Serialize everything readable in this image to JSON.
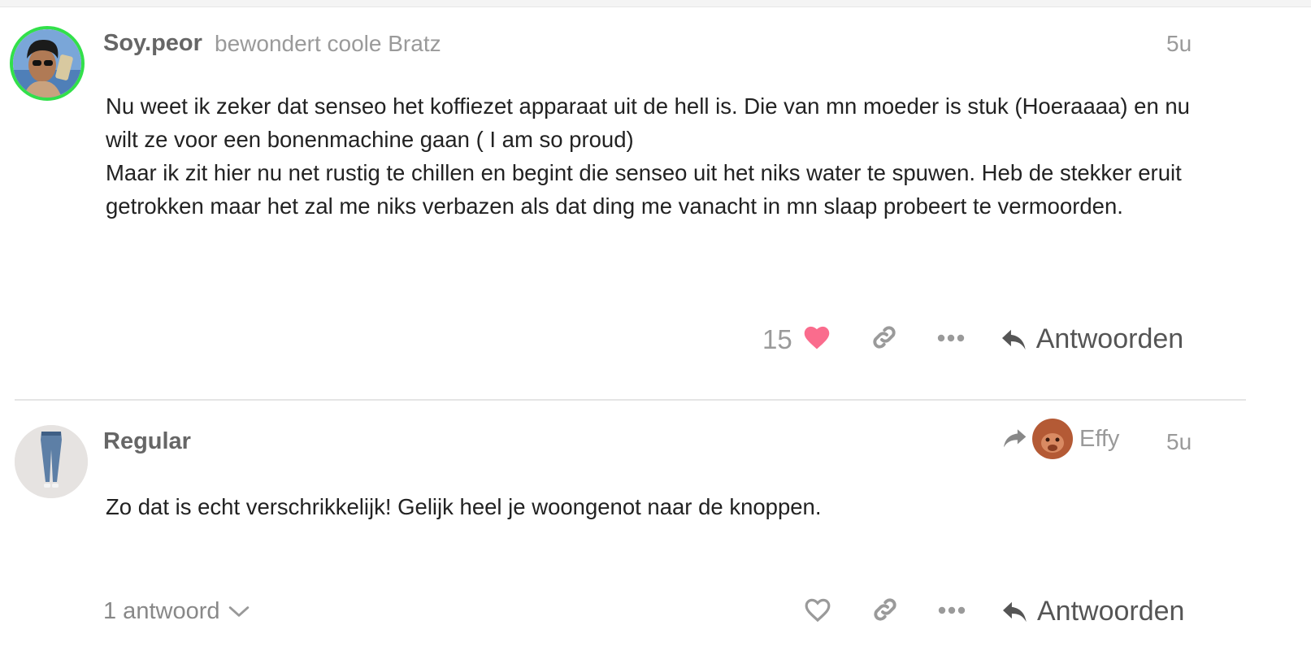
{
  "posts": [
    {
      "username": "Soy.peor",
      "user_title": "bewondert coole Bratz",
      "date": "5u",
      "paragraphs": [
        "Nu weet ik zeker dat senseo het koffiezet apparaat uit de hell is. Die van mn moeder is stuk (Hoeraaaa) en nu wilt ze voor een bonenmachine gaan ( I am so proud)",
        "Maar ik zit hier nu net rustig te chillen en begint die senseo uit het niks water te spuwen. Heb de stekker eruit getrokken maar het zal me niks verbazen als dat ding me vanacht in mn slaap probeert te vermoorden."
      ],
      "like_count": "15",
      "reply_label": "Antwoorden"
    },
    {
      "username": "Regular",
      "reply_to_name": "Effy",
      "date": "5u",
      "paragraphs": [
        "Zo dat is echt verschrikkelijk! Gelijk heel je woongenot naar de knoppen."
      ],
      "replies_toggle": "1 antwoord",
      "reply_label": "Antwoorden"
    }
  ],
  "icons": {
    "like_filled": "heart-filled-icon",
    "like_outline": "heart-outline-icon",
    "share": "link-icon",
    "more": "ellipsis-icon",
    "reply": "reply-arrow-icon",
    "reply_to": "share-arrow-icon",
    "expand": "chevron-down-icon"
  },
  "colors": {
    "avatar_ring": "#32e04a",
    "liked_heart": "#fa6c8d",
    "muted_text": "#9a9a9a",
    "divider": "#e5e5e5"
  }
}
